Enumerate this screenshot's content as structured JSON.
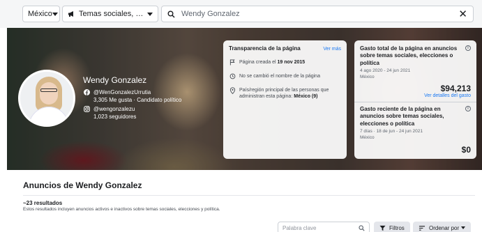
{
  "filters": {
    "country": "México",
    "ad_category": "Temas sociales, elecciones o política",
    "search_value": "Wendy Gonzalez"
  },
  "profile": {
    "name": "Wendy Gonzalez",
    "facebook_handle": "@WenGonzalezUrrutia",
    "facebook_stats": "3,305 Me gusta · Candidato político",
    "instagram_handle": "@wengonzalezu",
    "instagram_stats": "1,023 seguidores"
  },
  "transparency": {
    "title": "Transparencia de la página",
    "see_more": "Ver más",
    "created_prefix": "Página creada el",
    "created_date": "19 nov 2015",
    "name_change": "No se cambió el nombre de la página",
    "country_text": "País/región principal de las personas que administran esta página:",
    "country_value": "México (9)"
  },
  "spend_total": {
    "title": "Gasto total de la página en anuncios sobre temas sociales, elecciones o política",
    "dates": "4 ago 2020 - 24 jun 2021",
    "country": "México",
    "amount": "$94,213",
    "details_link": "Ver detalles del gasto"
  },
  "spend_recent": {
    "title": "Gasto reciente de la página en anuncios sobre temas sociales, elecciones o política",
    "dates": "7 días · 18 de jun - 24 jun 2021",
    "country": "México",
    "amount": "$0"
  },
  "ads_section": {
    "title": "Anuncios de Wendy Gonzalez",
    "result_count": "~23 resultados",
    "result_desc": "Estos resultados incluyen anuncios activos e inactivos sobre temas sociales, elecciones y política.",
    "keyword_placeholder": "Palabra clave",
    "filters_label": "Filtros",
    "sort_label": "Ordenar por"
  },
  "icons": {
    "category": "megaphone-icon",
    "search": "search-icon",
    "clear": "close-icon",
    "facebook": "facebook-icon",
    "instagram": "instagram-icon",
    "info": "info-icon",
    "filter": "filter-icon",
    "sort": "sort-icon"
  },
  "colors": {
    "link": "#1877f2",
    "button_bg": "#e4e6eb",
    "topbar_bg": "#f5f6f7"
  }
}
